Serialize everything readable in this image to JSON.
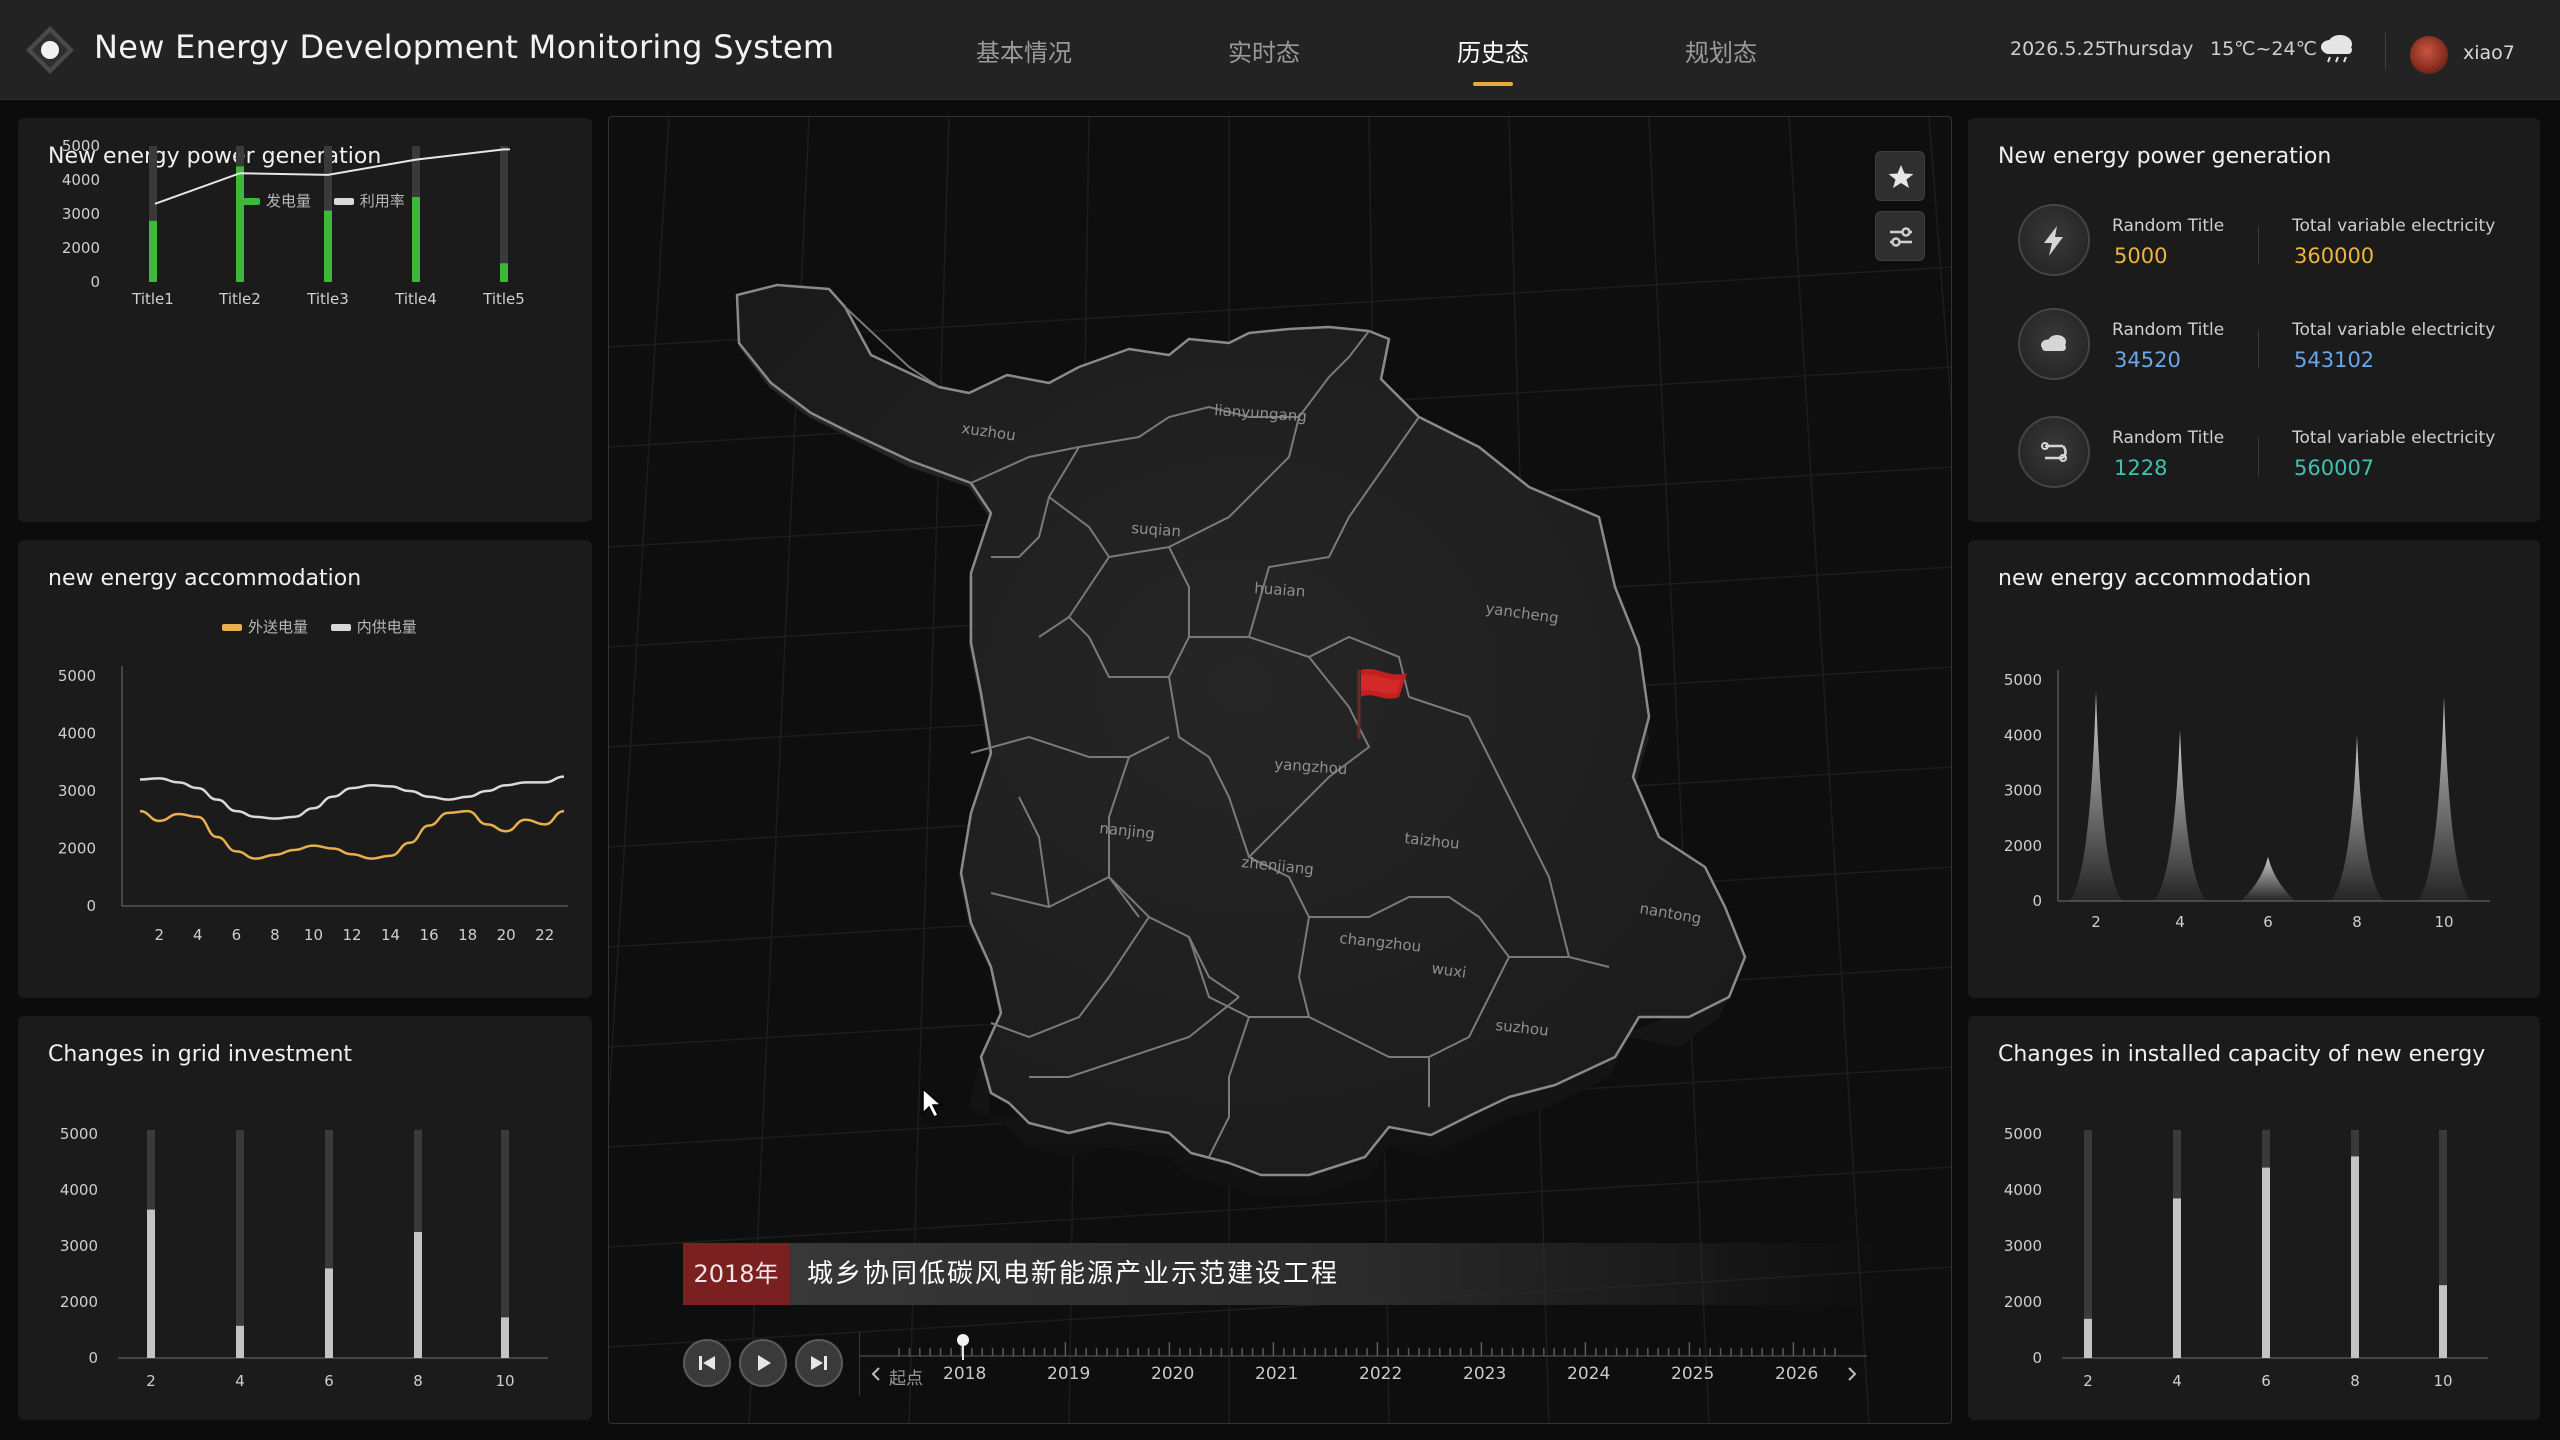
{
  "header": {
    "title": "New Energy Development Monitoring System",
    "tabs": [
      {
        "label": "基本情况",
        "active": false
      },
      {
        "label": "实时态",
        "active": false
      },
      {
        "label": "历史态",
        "active": true
      },
      {
        "label": "规划态",
        "active": false
      }
    ],
    "date": "2026.5.25",
    "weekday": "Thursday",
    "temperature": "15℃~24℃",
    "weather_icon": "cloud-rain-icon",
    "username": "xiao7",
    "accent_color": "#e8a83a"
  },
  "left": {
    "power_generation": {
      "title": "New energy power generation",
      "legend": [
        "发电量",
        "利用率"
      ],
      "chart_data": {
        "type": "bar",
        "categories": [
          "Title1",
          "Title2",
          "Title3",
          "Title4",
          "Title5"
        ],
        "series": [
          {
            "name": "发电量",
            "type": "bar",
            "values": [
              2800,
              4400,
              3100,
              3500,
              1100
            ]
          },
          {
            "name": "利用率",
            "type": "line",
            "values": [
              3300,
              4200,
              4150,
              4600,
              4900
            ]
          }
        ],
        "track_max": 5000,
        "yticks": [
          0,
          1000,
          2000,
          3000,
          4000,
          5000
        ],
        "ytick_labels": [
          "0",
          "2000",
          "3000",
          "4000",
          "5000"
        ],
        "ylim": [
          0,
          5000
        ],
        "colors": {
          "bar": "#3db83a",
          "line": "#e6e6e6",
          "track": "#3a3a3a"
        }
      }
    },
    "accommodation": {
      "title": "new energy accommodation",
      "legend": [
        "外送电量",
        "内供电量"
      ],
      "chart_data": {
        "type": "line",
        "x": [
          1,
          2,
          3,
          4,
          5,
          6,
          7,
          8,
          9,
          10,
          11,
          12,
          13,
          14,
          15,
          16,
          17,
          18,
          19,
          20,
          21,
          22,
          23
        ],
        "xticks": [
          "2",
          "4",
          "6",
          "8",
          "10",
          "12",
          "14",
          "16",
          "18",
          "20",
          "22"
        ],
        "series": [
          {
            "name": "外送电量",
            "values": [
              2650,
              2480,
              2600,
              2550,
              2200,
              1900,
              1650,
              1780,
              1950,
              2050,
              2000,
              1800,
              1650,
              1750,
              2100,
              2400,
              2620,
              2650,
              2420,
              2300,
              2500,
              2420,
              2650
            ]
          },
          {
            "name": "内供电量",
            "values": [
              3200,
              3220,
              3150,
              3050,
              2850,
              2650,
              2550,
              2520,
              2550,
              2700,
              2900,
              3050,
              3100,
              3080,
              3000,
              2900,
              2850,
              2900,
              3000,
              3100,
              3150,
              3150,
              3250
            ]
          }
        ],
        "ytick_labels": [
          "0",
          "2000",
          "3000",
          "4000",
          "5000"
        ],
        "ylim": [
          0,
          5000
        ],
        "colors": {
          "外送电量": "#e8b04a",
          "内供电量": "#d9d9d9"
        }
      }
    },
    "grid_investment": {
      "title": "Changes in grid investment",
      "chart_data": {
        "type": "bar",
        "categories": [
          "2",
          "4",
          "6",
          "8",
          "10"
        ],
        "values": [
          3650,
          1150,
          2600,
          3250,
          1450
        ],
        "track_max": 5000,
        "ytick_labels": [
          "0",
          "2000",
          "3000",
          "4000",
          "5000"
        ],
        "ylim": [
          0,
          5000
        ],
        "colors": {
          "bar": "#c4c4c4",
          "track": "#3a3a3a"
        }
      }
    }
  },
  "map": {
    "cities": [
      "xuzhou",
      "lianyungang",
      "suqian",
      "huaian",
      "yancheng",
      "yangzhou",
      "taizhou",
      "nanjing",
      "zhenjiang",
      "changzhou",
      "wuxi",
      "suzhou",
      "nantong"
    ],
    "banner_year": "2018年",
    "banner_text": "城乡协同低碳风电新能源产业示范建设工程",
    "timeline_start": "起点",
    "timeline_years": [
      "2018",
      "2019",
      "2020",
      "2021",
      "2022",
      "2023",
      "2024",
      "2025",
      "2026"
    ],
    "timeline_current": "2018",
    "tools": [
      "star-icon",
      "filter-icon"
    ]
  },
  "right": {
    "power_generation": {
      "title": "New energy power generation",
      "rows": [
        {
          "icon": "lightning-icon",
          "label": "Random Title",
          "value": "5000",
          "total_label": "Total variable electricity",
          "total_value": "360000",
          "color": "#f0b43c"
        },
        {
          "icon": "cloud-icon",
          "label": "Random Title",
          "value": "34520",
          "total_label": "Total variable electricity",
          "total_value": "543102",
          "color": "#6aa6e8"
        },
        {
          "icon": "transfer-icon",
          "label": "Random Title",
          "value": "1228",
          "total_label": "Total variable electricity",
          "total_value": "560007",
          "color": "#3ec3b0"
        }
      ]
    },
    "accommodation": {
      "title": "new energy accommodation",
      "chart_data": {
        "type": "area",
        "categories": [
          "2",
          "4",
          "6",
          "8",
          "10"
        ],
        "values": [
          4800,
          4100,
          1600,
          4000,
          4700
        ],
        "ytick_labels": [
          "0",
          "2000",
          "3000",
          "4000",
          "5000"
        ],
        "ylim": [
          0,
          5000
        ]
      }
    },
    "installed_capacity": {
      "title": "Changes in installed capacity of new energy",
      "chart_data": {
        "type": "bar",
        "categories": [
          "2",
          "4",
          "6",
          "8",
          "10"
        ],
        "values": [
          1400,
          3850,
          4400,
          4600,
          2300
        ],
        "track_max": 5000,
        "ytick_labels": [
          "0",
          "2000",
          "3000",
          "4000",
          "5000"
        ],
        "ylim": [
          0,
          5000
        ],
        "colors": {
          "bar": "#c4c4c4",
          "track": "#3a3a3a"
        }
      }
    }
  }
}
